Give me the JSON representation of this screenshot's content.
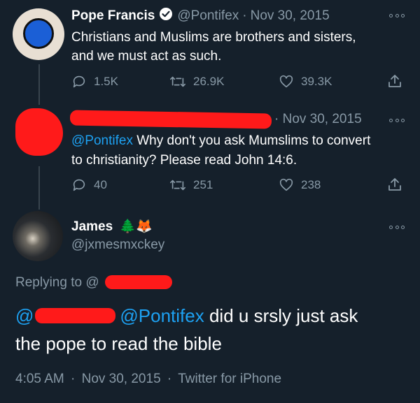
{
  "tweet1": {
    "name": "Pope Francis",
    "handle": "@Pontifex",
    "sep": "·",
    "date": "Nov 30, 2015",
    "text_line1": "Christians and Muslims are brothers and sisters,",
    "text_line2": "and we must act as such.",
    "replies": "1.5K",
    "retweets": "26.9K",
    "likes": "39.3K"
  },
  "tweet2": {
    "date": "· Nov 30, 2015",
    "mention": "@Pontifex",
    "text_line1": " Why don't you ask Mumslims to convert",
    "text_line2": "to christianity? Please read John 14:6.",
    "replies": "40",
    "retweets": "251",
    "likes": "238"
  },
  "tweet3": {
    "name": "James",
    "emoji": "🌲🦊",
    "handle": "@jxmesmxckey",
    "replying_to": "Replying to @",
    "mention_start": "@",
    "mention_pontifex": "@Pontifex",
    "text_rest": " did u srsly just ask",
    "text_line2": "the pope to read the bible",
    "time": "4:05 AM",
    "sep1": "·",
    "date": "Nov 30, 2015",
    "sep2": "·",
    "client": "Twitter for iPhone"
  },
  "colors": {
    "background": "#15202b",
    "muted": "#8899a6",
    "link": "#1da1f2",
    "verified": "#ffffff",
    "redaction": "#ff1a1a"
  }
}
